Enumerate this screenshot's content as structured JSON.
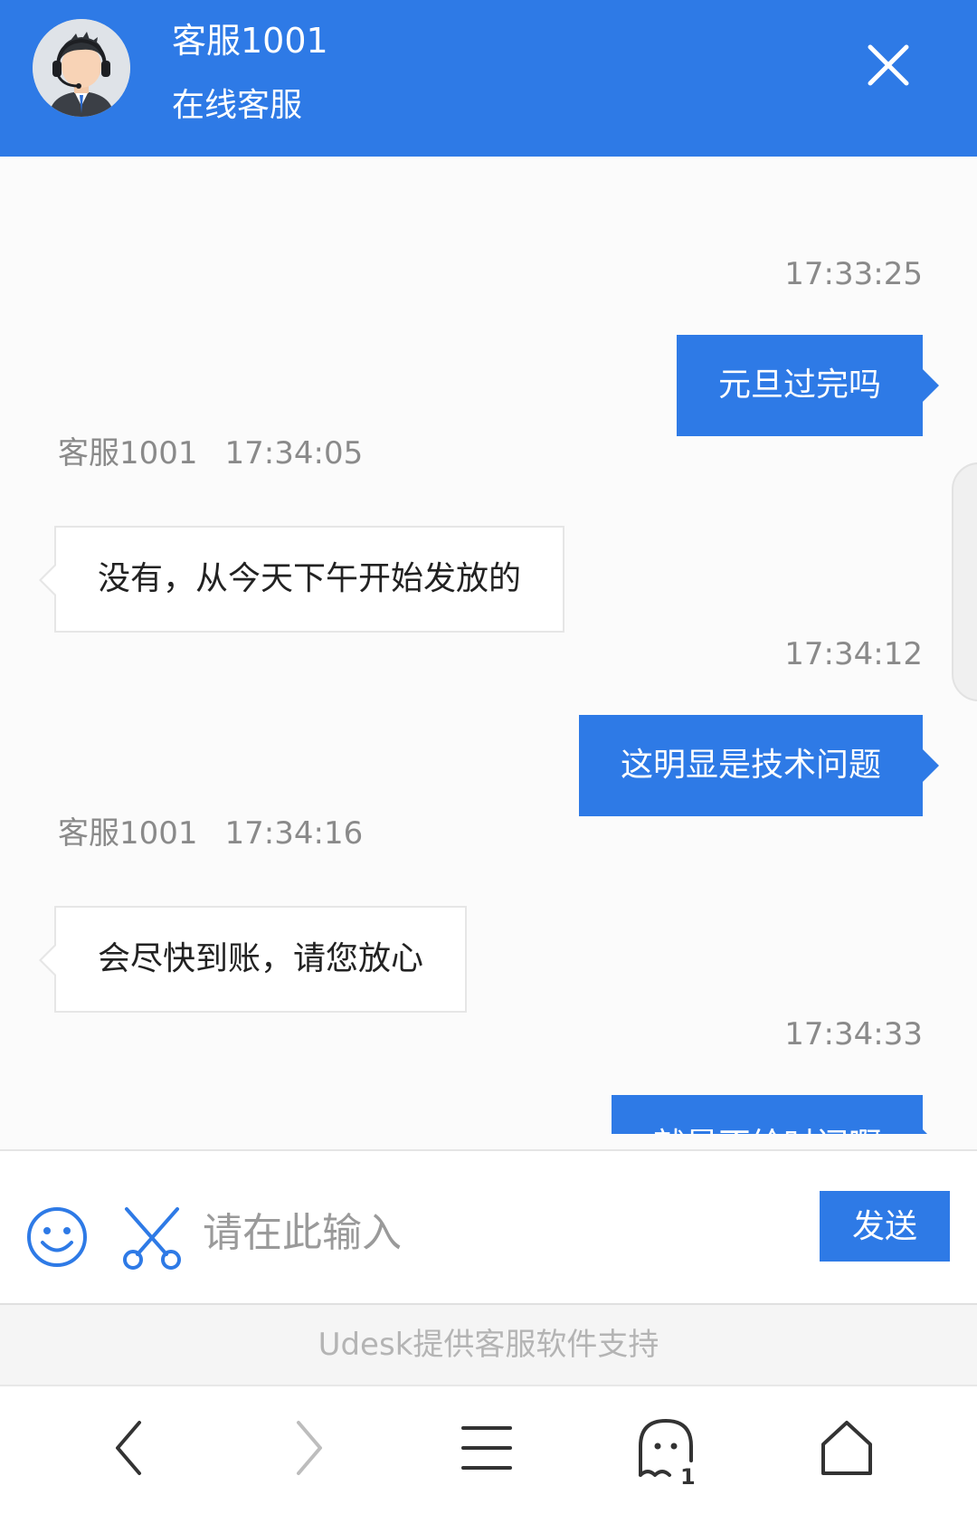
{
  "header": {
    "agent_name": "客服1001",
    "agent_status": "在线客服",
    "avatar_icon": "customer-service-agent-avatar",
    "close_icon": "close-icon",
    "background_color": "#2e7ae6"
  },
  "messages": [
    {
      "direction": "out",
      "time": "17:33:25",
      "text": "元旦过完吗"
    },
    {
      "direction": "in",
      "sender": "客服1001",
      "time": "17:34:05",
      "text": "没有，从今天下午开始发放的"
    },
    {
      "direction": "out",
      "time": "17:34:12",
      "text": "这明显是技术问题"
    },
    {
      "direction": "in",
      "sender": "客服1001",
      "time": "17:34:16",
      "text": "会尽快到账，请您放心"
    },
    {
      "direction": "out",
      "time": "17:34:33",
      "text": "就是不给时间啊"
    }
  ],
  "input_bar": {
    "emoji_icon": "smiley-icon",
    "screenshot_icon": "scissors-icon",
    "placeholder": "请在此输入",
    "send_label": "发送"
  },
  "footer": {
    "powered_by": "Udesk提供客服软件支持"
  },
  "browser_nav": {
    "back_icon": "chevron-left-icon",
    "forward_icon": "chevron-right-icon",
    "menu_icon": "menu-icon",
    "tabs_icon": "ghost-tabs-icon",
    "tab_count": "1",
    "home_icon": "home-icon"
  },
  "colors": {
    "accent": "#2e7ae6",
    "chat_bg": "#fbfbfb",
    "meta_text": "#8a8a8a"
  }
}
